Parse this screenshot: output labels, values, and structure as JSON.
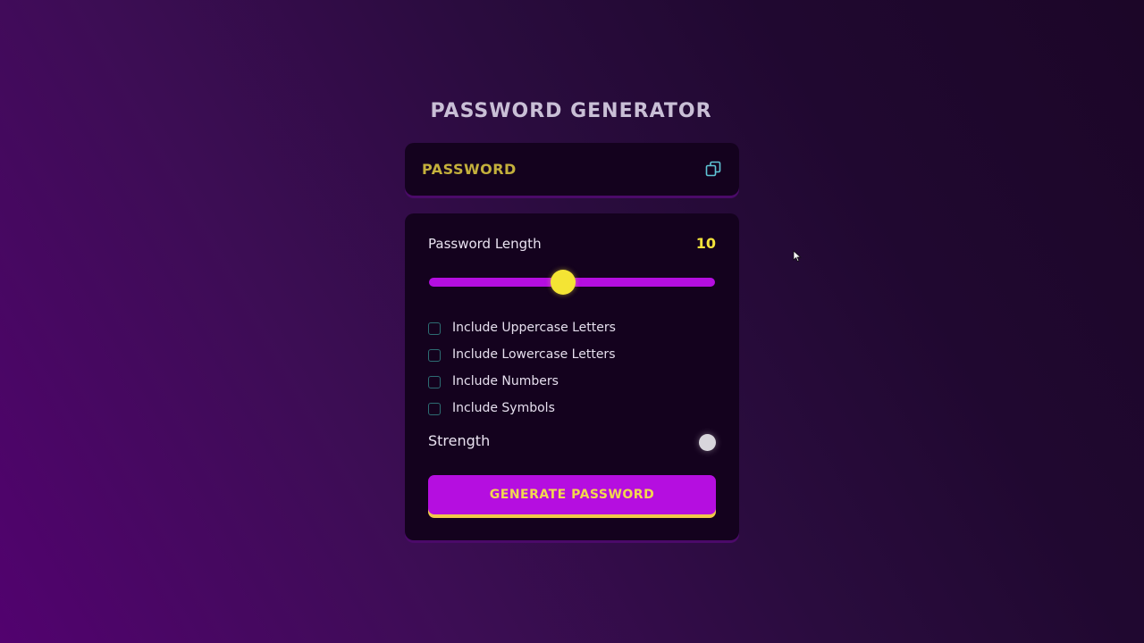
{
  "app": {
    "title": "PASSWORD GENERATOR"
  },
  "password_display": {
    "value": "PASSWORD",
    "copy_icon": "copy-icon"
  },
  "length": {
    "label": "Password Length",
    "value": "10",
    "slider_fraction": 0.47
  },
  "options": [
    {
      "label": "Include Uppercase Letters",
      "checked": false
    },
    {
      "label": "Include Lowercase Letters",
      "checked": false
    },
    {
      "label": "Include Numbers",
      "checked": false
    },
    {
      "label": "Include Symbols",
      "checked": false
    }
  ],
  "strength": {
    "label": "Strength",
    "indicator_color": "#d8d6dc"
  },
  "generate_button": {
    "label": "GENERATE PASSWORD"
  },
  "colors": {
    "accent": "#b50ee0",
    "highlight": "#f4e434",
    "card_bg": "#14021e",
    "password_text": "#c4b03c",
    "copy_icon": "#5fc6d6"
  }
}
